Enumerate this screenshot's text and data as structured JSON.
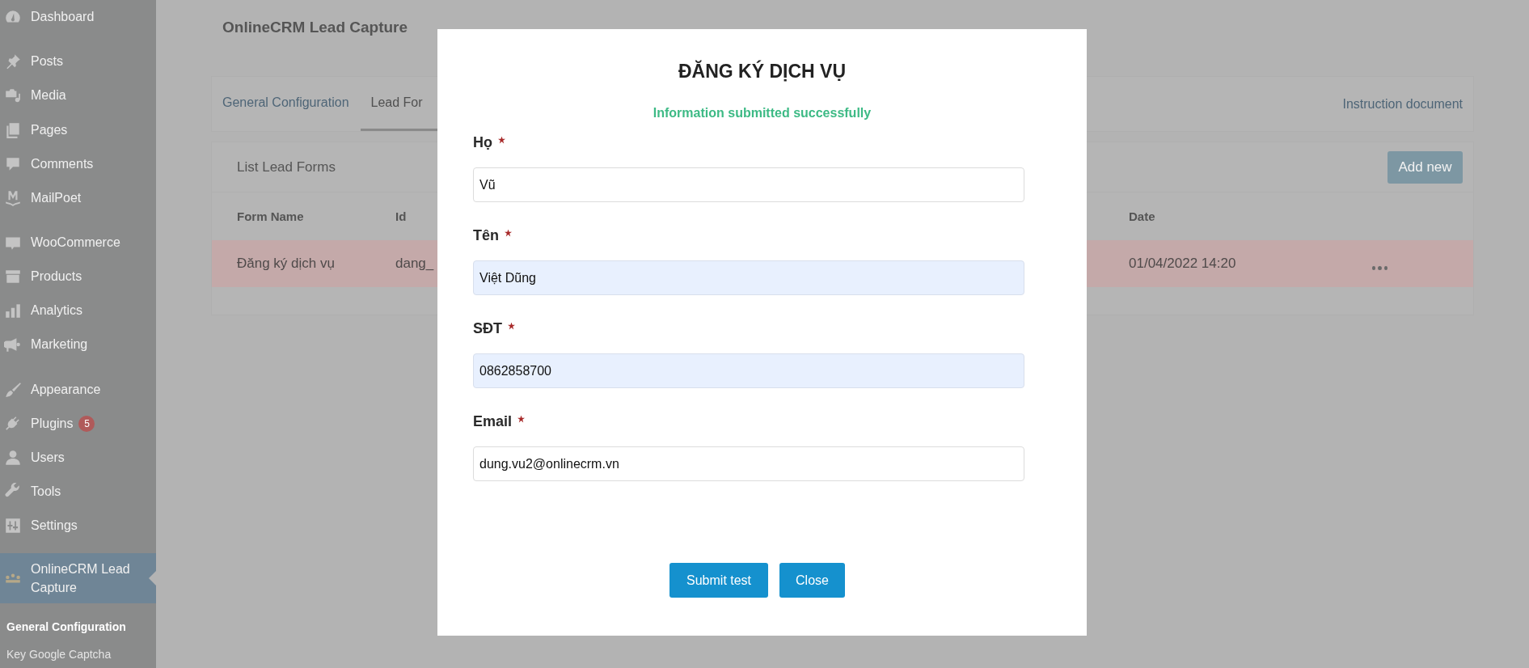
{
  "sidebar": {
    "items": [
      {
        "label": "Dashboard",
        "gap_before": false,
        "selected": false
      },
      {
        "label": "Posts",
        "gap_before": true,
        "selected": false
      },
      {
        "label": "Media",
        "gap_before": false,
        "selected": false
      },
      {
        "label": "Pages",
        "gap_before": false,
        "selected": false
      },
      {
        "label": "Comments",
        "gap_before": false,
        "selected": false
      },
      {
        "label": "MailPoet",
        "gap_before": false,
        "selected": false
      },
      {
        "label": "WooCommerce",
        "gap_before": true,
        "selected": false
      },
      {
        "label": "Products",
        "gap_before": false,
        "selected": false
      },
      {
        "label": "Analytics",
        "gap_before": false,
        "selected": false
      },
      {
        "label": "Marketing",
        "gap_before": false,
        "selected": false
      },
      {
        "label": "Appearance",
        "gap_before": true,
        "selected": false
      },
      {
        "label": "Plugins",
        "badge": "5",
        "gap_before": false,
        "selected": false
      },
      {
        "label": "Users",
        "gap_before": false,
        "selected": false
      },
      {
        "label": "Tools",
        "gap_before": false,
        "selected": false
      },
      {
        "label": "Settings",
        "gap_before": false,
        "selected": false
      },
      {
        "label": "OnlineCRM Lead Capture",
        "gap_before": true,
        "selected": true
      }
    ],
    "submenu": [
      {
        "label": "General Configuration",
        "selected": true
      },
      {
        "label": "Key Google Captcha",
        "selected": false
      }
    ]
  },
  "page": {
    "title": "OnlineCRM Lead Capture"
  },
  "tabs": [
    {
      "label": "General Configuration",
      "selected": false
    },
    {
      "label": "Lead For",
      "selected": true
    }
  ],
  "instruction_link": "Instruction document",
  "list": {
    "title": "List Lead Forms",
    "add_button": "Add new",
    "columns": [
      "Form Name",
      "Id",
      "Date"
    ],
    "rows": [
      {
        "cells": [
          "Đăng ký dịch vụ",
          "dang_",
          "01/04/2022 14:20"
        ],
        "highlighted": true
      }
    ]
  },
  "modal": {
    "title": "ĐĂNG KÝ DỊCH VỤ",
    "message": "Information submitted successfully",
    "fields": [
      {
        "label": "Họ",
        "required": true,
        "value": "Vũ",
        "autofilled": false
      },
      {
        "label": "Tên",
        "required": true,
        "value": "Việt Dũng",
        "autofilled": true
      },
      {
        "label": "SĐT",
        "required": true,
        "value": "0862858700",
        "autofilled": true
      },
      {
        "label": "Email",
        "required": true,
        "value": "dung.vu2@onlinecrm.vn",
        "autofilled": false
      }
    ],
    "buttons": [
      "Submit test",
      "Close"
    ]
  }
}
